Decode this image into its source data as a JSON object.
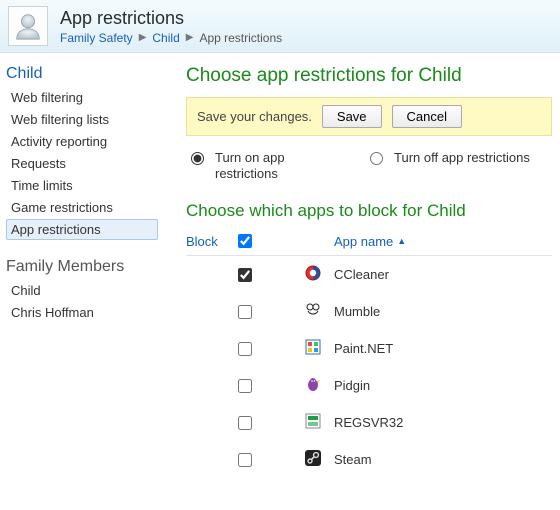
{
  "header": {
    "title": "App restrictions",
    "breadcrumb": [
      {
        "label": "Family Safety",
        "link": true
      },
      {
        "label": "Child",
        "link": true
      },
      {
        "label": "App restrictions",
        "link": false
      }
    ]
  },
  "sidebar": {
    "heading": "Child",
    "items": [
      {
        "label": "Web filtering"
      },
      {
        "label": "Web filtering lists"
      },
      {
        "label": "Activity reporting"
      },
      {
        "label": "Requests"
      },
      {
        "label": "Time limits"
      },
      {
        "label": "Game restrictions"
      },
      {
        "label": "App restrictions",
        "selected": true
      }
    ],
    "members_heading": "Family Members",
    "members": [
      {
        "label": "Child"
      },
      {
        "label": "Chris Hoffman"
      }
    ]
  },
  "main": {
    "title": "Choose app restrictions for Child",
    "savebar": {
      "message": "Save your changes.",
      "save_label": "Save",
      "cancel_label": "Cancel"
    },
    "radio_on_label": "Turn on app restrictions",
    "radio_off_label": "Turn off app restrictions",
    "radio_selected": "on",
    "subtitle": "Choose which apps to block for Child",
    "columns": {
      "block": "Block",
      "appname": "App name"
    },
    "apps": [
      {
        "checked": true,
        "name": "CCleaner",
        "icon": "ccleaner-icon"
      },
      {
        "checked": false,
        "name": "Mumble",
        "icon": "mumble-icon"
      },
      {
        "checked": false,
        "name": "Paint.NET",
        "icon": "paintnet-icon"
      },
      {
        "checked": false,
        "name": "Pidgin",
        "icon": "pidgin-icon"
      },
      {
        "checked": false,
        "name": "REGSVR32",
        "icon": "regsvr32-icon"
      },
      {
        "checked": false,
        "name": "Steam",
        "icon": "steam-icon"
      }
    ]
  }
}
